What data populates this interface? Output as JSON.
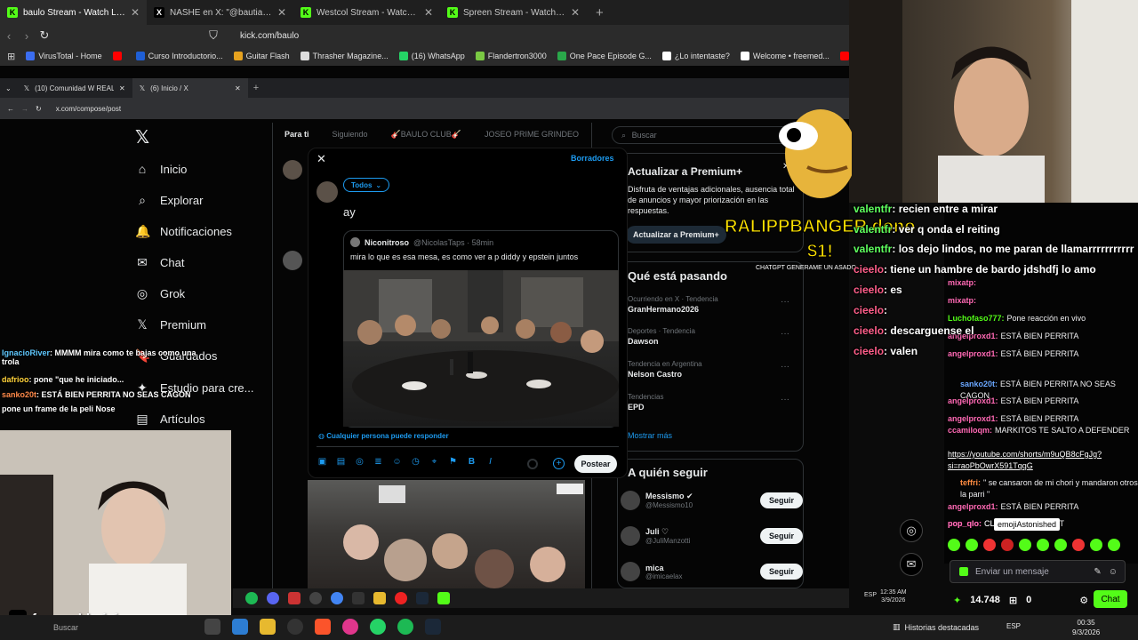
{
  "outer_tabs": [
    {
      "title": "baulo Stream - Watch Live on",
      "fav": "K",
      "color": "#53fc18",
      "active": true
    },
    {
      "title": "NASHE en X: \"@bautiagnone https://",
      "fav": "X",
      "color": "#000000",
      "active": false
    },
    {
      "title": "Westcol Stream - Watch Live on K",
      "fav": "K",
      "color": "#53fc18",
      "active": false
    },
    {
      "title": "Spreen Stream - Watch Live on K",
      "fav": "K",
      "color": "#53fc18",
      "active": false
    }
  ],
  "outer_url": "kick.com/baulo",
  "bookmarks": [
    {
      "label": "VirusTotal - Home",
      "color": "#3b6df0"
    },
    {
      "label": "",
      "color": "#ff0000"
    },
    {
      "label": "Curso Introductorio...",
      "color": "#1f5fd6"
    },
    {
      "label": "Guitar Flash",
      "color": "#e6a21f"
    },
    {
      "label": "Thrasher Magazine...",
      "color": "#dddddd"
    },
    {
      "label": "(16) WhatsApp",
      "color": "#25d366"
    },
    {
      "label": "Flandertron3000",
      "color": "#7ac943"
    },
    {
      "label": "One Pace Episode G...",
      "color": "#2aa84a"
    },
    {
      "label": "¿Lo intentaste?",
      "color": "#ffffff"
    },
    {
      "label": "Welcome • freemed...",
      "color": "#ffffff"
    },
    {
      "label": "",
      "color": "#ff0000"
    },
    {
      "label": "Retakes CS",
      "color": "#d33"
    },
    {
      "label": "Y",
      "color": "#d33"
    }
  ],
  "inner_tabs": [
    {
      "title": "(10) Comunidad W REALS 🔥 /",
      "active": false
    },
    {
      "title": "(6) Inicio / X",
      "active": true
    }
  ],
  "inner_url": "x.com/compose/post",
  "x_nav": [
    {
      "label": "Inicio",
      "icon": "⌂"
    },
    {
      "label": "Explorar",
      "icon": "⌕"
    },
    {
      "label": "Notificaciones",
      "icon": "🔔"
    },
    {
      "label": "Chat",
      "icon": "✉"
    },
    {
      "label": "Grok",
      "icon": "◎"
    },
    {
      "label": "Premium",
      "icon": "𝕏"
    },
    {
      "label": "Guardados",
      "icon": "🔖"
    },
    {
      "label": "Estudio para cre...",
      "icon": "✦"
    },
    {
      "label": "Artículos",
      "icon": "▤"
    }
  ],
  "feed_tabs": [
    "Para ti",
    "Siguiendo",
    "🎸BAULO CLUB🎸",
    "JOSEO PRIME GRINDEO"
  ],
  "search_placeholder": "Buscar",
  "premium": {
    "title": "Actualizar a Premium+",
    "text": "Disfruta de ventajas adicionales, ausencia total de anuncios y mayor priorización en las respuestas.",
    "button": "Actualizar a Premium+"
  },
  "trends_title": "Qué está pasando",
  "trends": [
    {
      "cat": "Ocurriendo en X · Tendencia",
      "name": "GranHermano2026"
    },
    {
      "cat": "Deportes · Tendencia",
      "name": "Dawson"
    },
    {
      "cat": "Tendencia en Argentina",
      "name": "Nelson Castro"
    },
    {
      "cat": "Tendencias",
      "name": "EPD"
    }
  ],
  "show_more": "Mostrar más",
  "follow_title": "A quién seguir",
  "follow": [
    {
      "name": "Messismo ✔",
      "handle": "@Messismo10",
      "button": "Seguir"
    },
    {
      "name": "Juli ♡",
      "handle": "@JuliManzotti",
      "button": "Seguir"
    },
    {
      "name": "mica",
      "handle": "@imicaelax",
      "button": "Seguir"
    }
  ],
  "compose": {
    "close": "✕",
    "drafts": "Borradores",
    "audience": "Todos",
    "text": "ay",
    "quote_name": "Niconitroso",
    "quote_handle": "@NicolasTaps · 58min",
    "quote_text": "mira lo que es esa mesa, es como ver a p diddy y epstein juntos",
    "reply_setting": "Cualquier persona puede responder",
    "post_button": "Postear"
  },
  "overlay": {
    "banner": "RALIPPBANGER dono",
    "amount": "$1!",
    "subtext": "CHATGPT GENERAME UN ASADO"
  },
  "big_chat": [
    {
      "user": "valentfr",
      "text": ": recien entre a mirar",
      "color": "green"
    },
    {
      "user": "valentfr",
      "text": ": ver q onda el reiting",
      "color": "green"
    },
    {
      "user": "valentfr",
      "text": ": los dejo lindos, no me paran de llamarrrrrrrrrrr",
      "color": "green"
    },
    {
      "user": "cieelo",
      "text": ": tiene un hambre de bardo jdshdfj lo amo",
      "color": "pink"
    },
    {
      "user": "cieelo",
      "text": ": es",
      "color": "pink"
    },
    {
      "user": "cieelo",
      "text": ":",
      "color": "pink"
    },
    {
      "user": "cieelo",
      "text": ": descarguense el",
      "color": "pink"
    },
    {
      "user": "cieelo",
      "text": ": valen",
      "color": "pink"
    }
  ],
  "chat": [
    {
      "user": "mixatp:",
      "text": "",
      "cls": "pink"
    },
    {
      "user": "mixatp:",
      "text": "",
      "cls": "pink"
    },
    {
      "user": "Luchofaso777:",
      "text": "Pone reacción en vivo",
      "cls": "green"
    },
    {
      "user": "angelproxd1:",
      "text": "ESTÁ BIEN PERRITA",
      "cls": "pink"
    },
    {
      "user": "angelproxd1:",
      "text": "ESTÁ BIEN PERRITA",
      "cls": "pink"
    },
    {
      "user": "sanko20t:",
      "text": "ESTÁ BIEN PERRITA NO SEAS CAGON",
      "cls": "blue"
    },
    {
      "user": "angelproxd1:",
      "text": "ESTÁ BIEN PERRITA",
      "cls": "pink"
    },
    {
      "user": "angelproxd1:",
      "text": "ESTÁ BIEN PERRITA",
      "cls": "pink"
    },
    {
      "user": "ccamiloqm:",
      "text": "MARKITOS TE SALTO A DEFENDER",
      "cls": "pink"
    },
    {
      "user": "",
      "text": "https://youtube.com/shorts/m9uQB8cFgJg?si=raoPbOwrX591TqqG",
      "cls": "link"
    },
    {
      "user": "teffri:",
      "text": "\" se cansaron de mi chori y mandaron otros a la parri \"",
      "cls": "orange"
    },
    {
      "user": "angelproxd1:",
      "text": "ESTÁ BIEN PERRITA",
      "cls": "pink"
    },
    {
      "user": "pop_qlo:",
      "text": "CLONARON AL CHAT",
      "cls": "pink"
    },
    {
      "user": "pop_qlo:",
      "text": "CL",
      "cls": "pink"
    }
  ],
  "emote_tooltip": "emojiAstonished",
  "chat_input_placeholder": "Enviar un mensaje",
  "chat_footer": {
    "points": "14.748",
    "count": "0",
    "chat_button": "Chat"
  },
  "left_chat": [
    {
      "user": "IgnacioRiver",
      "text": ": MMMM mira como te bajas como una trola"
    },
    {
      "user": "dafrioo",
      "text": ": pone \"que he iniciado..."
    },
    {
      "user": "sanko20t",
      "text": ": ESTÁ BIEN PERRITA NO SEAS CAGON"
    },
    {
      "user": "",
      "text": "pone un frame de la peli Nose"
    }
  ],
  "tiktok_handle": "facu.calderini",
  "inner_clock": {
    "time": "12:35 AM",
    "date": "3/9/2026",
    "lang": "ESP"
  },
  "taskbar": {
    "search": "Buscar",
    "widget": "Historias destacadas",
    "lang": "ESP",
    "time": "00:35",
    "date": "9/3/2026"
  }
}
